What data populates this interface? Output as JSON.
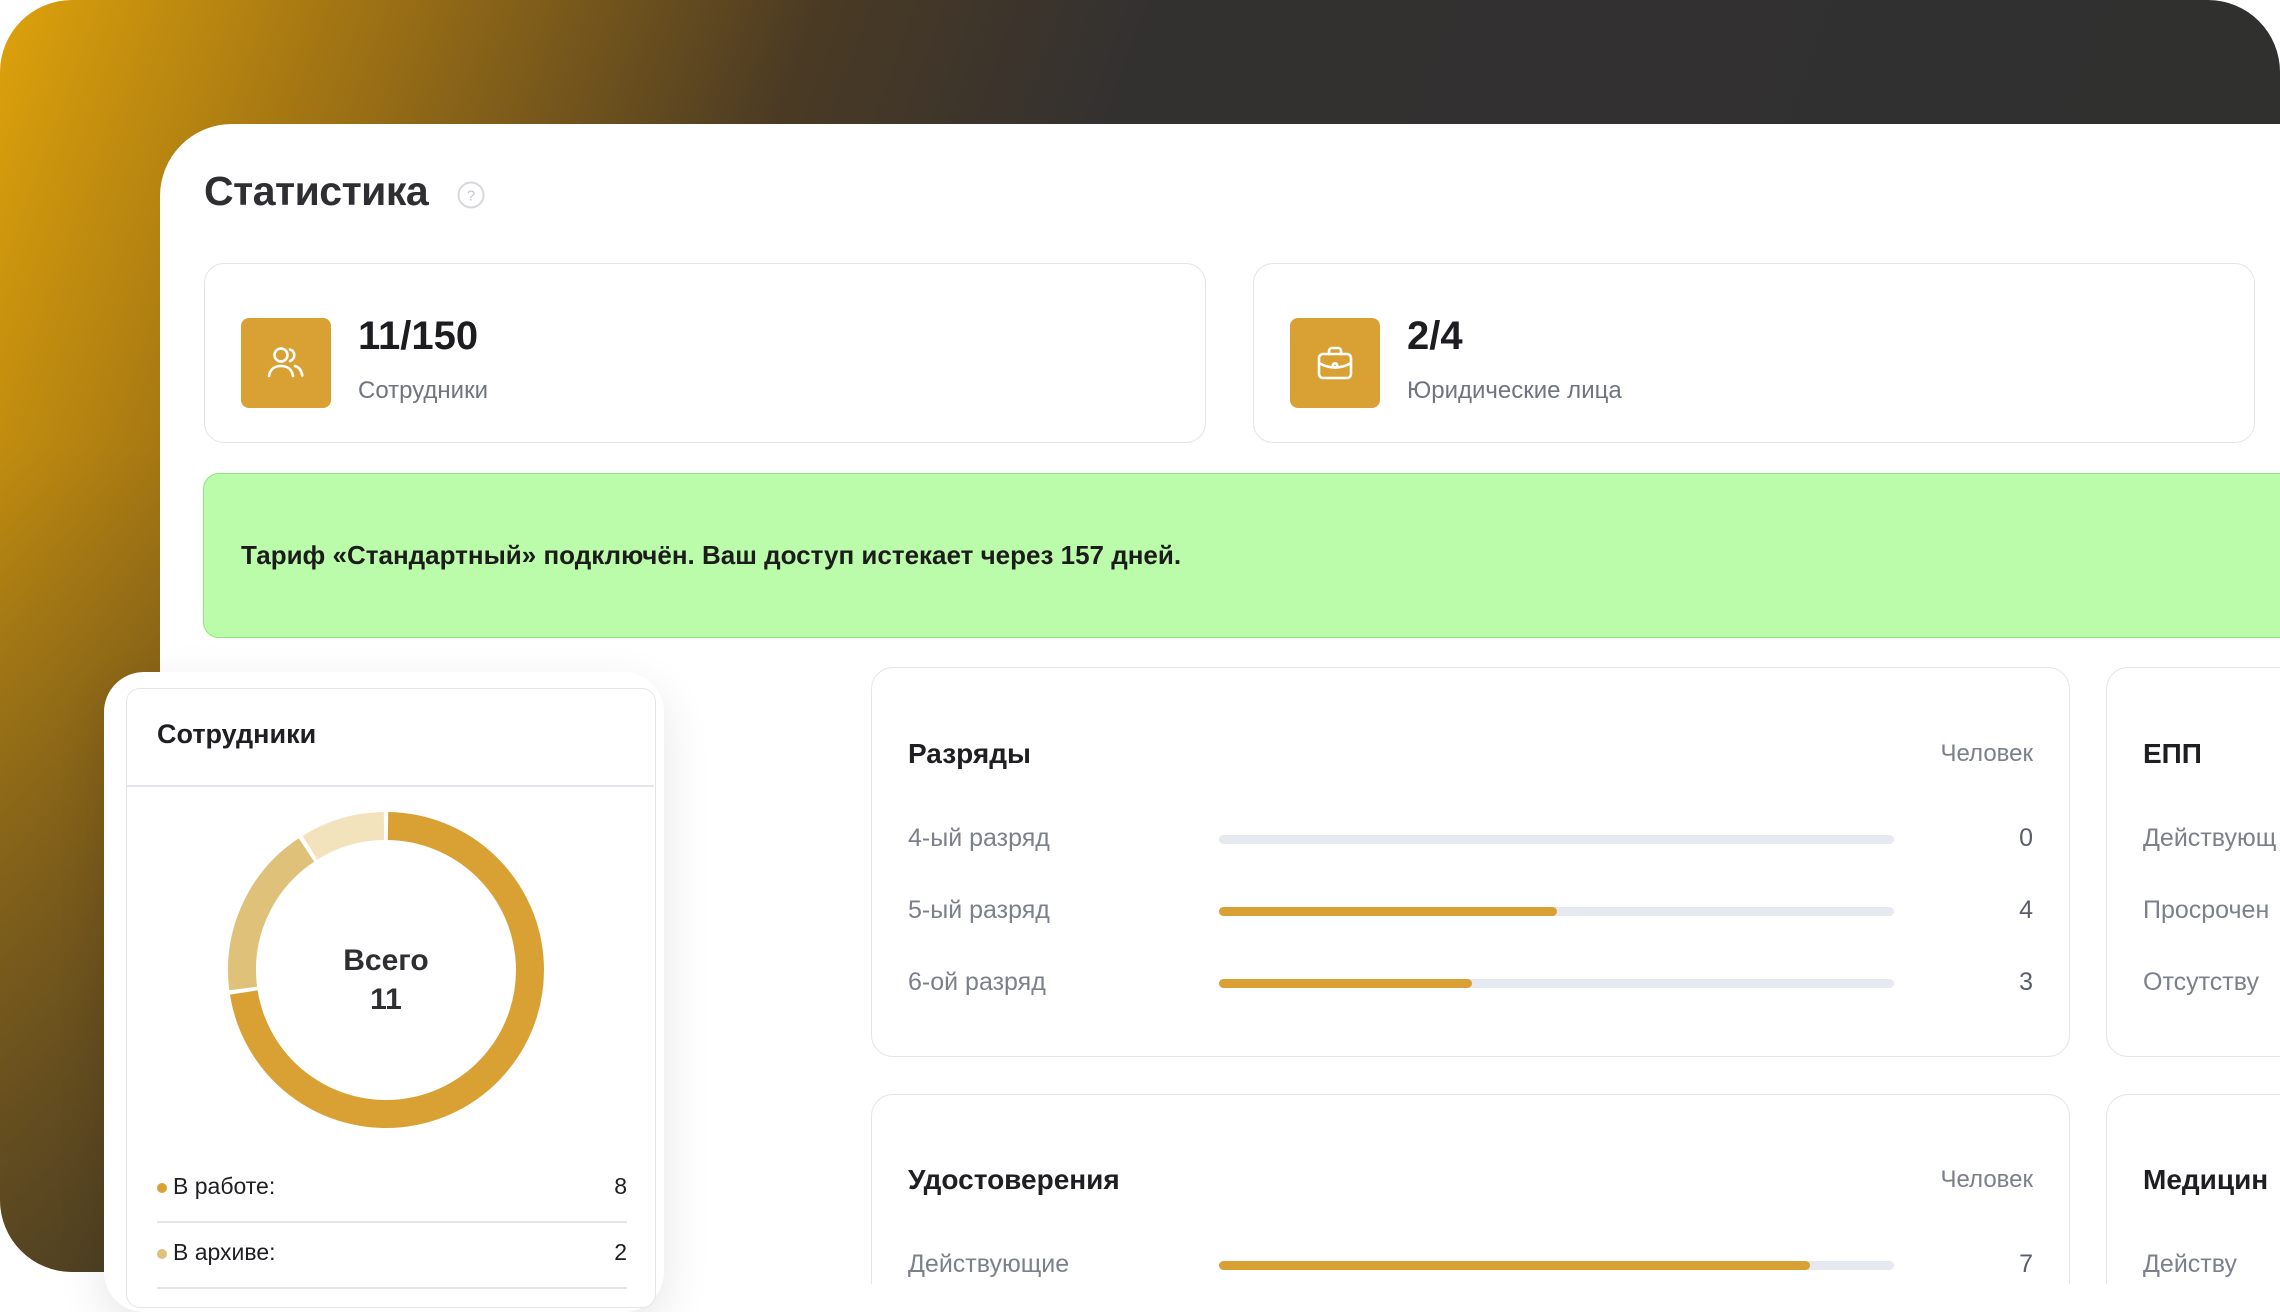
{
  "page": {
    "title": "Статистика",
    "help_icon": "question-circle-icon"
  },
  "stats": [
    {
      "value": "11/150",
      "label": "Сотрудники",
      "icon": "users-icon"
    },
    {
      "value": "2/4",
      "label": "Юридические лица",
      "icon": "briefcase-icon"
    }
  ],
  "tariff": {
    "text": "Тариф «Стандартный» подключён. Ваш доступ истекает через 157 дней."
  },
  "ranks": {
    "title": "Разряды",
    "unit": "Человек",
    "rows": [
      {
        "label": "4-ый разряд",
        "value": "0",
        "fraction": 0
      },
      {
        "label": "5-ый разряд",
        "value": "4",
        "fraction": 0.5
      },
      {
        "label": "6-ой разряд",
        "value": "3",
        "fraction": 0.375
      }
    ]
  },
  "epp": {
    "title": "ЕПП",
    "rows": [
      {
        "label": "Действующ"
      },
      {
        "label": "Просрочен"
      },
      {
        "label": "Отсутству"
      }
    ]
  },
  "certificates": {
    "title": "Удостоверения",
    "unit": "Человек",
    "rows": [
      {
        "label": "Действующие",
        "value": "7",
        "fraction": 0.875
      }
    ]
  },
  "medical": {
    "title": "Медицин",
    "rows": [
      {
        "label": "Действу"
      }
    ]
  },
  "employees": {
    "title": "Сотрудники",
    "total_label": "Всего",
    "total_value": "11",
    "legend": [
      {
        "label": "В работе:",
        "value": "8",
        "color": "#d9a133"
      },
      {
        "label": "В архиве:",
        "value": "2",
        "color": "#dfc17a"
      }
    ],
    "donut_segments": [
      {
        "value": 8,
        "color": "#d9a133"
      },
      {
        "value": 2,
        "color": "#dfc17a"
      },
      {
        "value": 1,
        "color": "#f3e3bd"
      }
    ]
  },
  "colors": {
    "accent": "#d9a133",
    "success_bg": "#bbfcaa"
  }
}
